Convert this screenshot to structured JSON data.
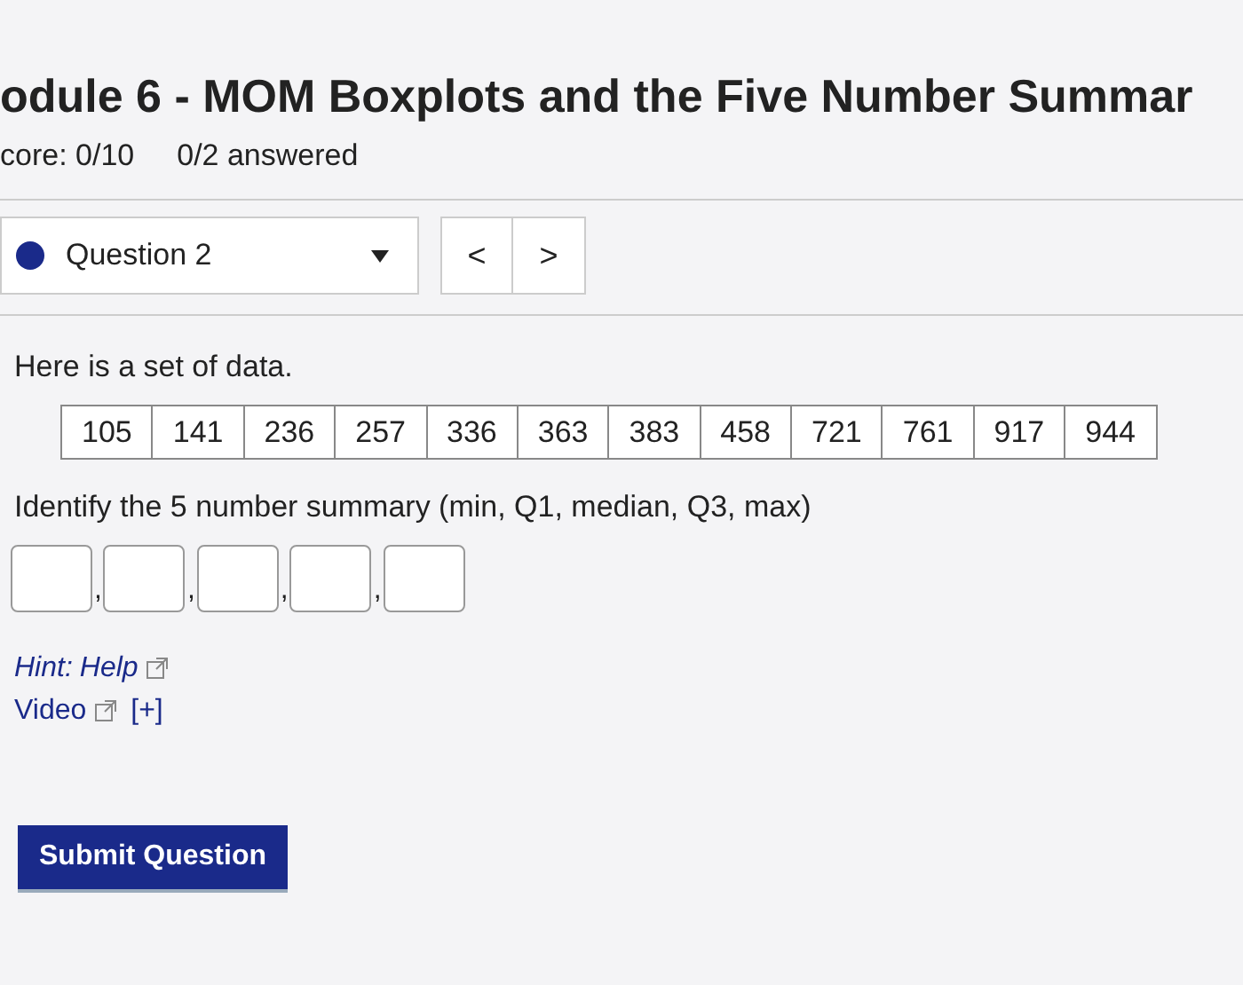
{
  "header": {
    "title": "odule 6 - MOM Boxplots and the Five Number Summar",
    "score": "core: 0/10",
    "answered": "0/2 answered"
  },
  "question_nav": {
    "label": "Question 2",
    "prev": "<",
    "next": ">"
  },
  "intro": "Here is a set of data.",
  "data_values": [
    "105",
    "141",
    "236",
    "257",
    "336",
    "363",
    "383",
    "458",
    "721",
    "761",
    "917",
    "944"
  ],
  "prompt": "Identify the 5 number summary (min, Q1, median, Q3, max)",
  "answer_fields": [
    {
      "kind": "input",
      "separator": ","
    },
    {
      "kind": "input",
      "separator": ","
    },
    {
      "kind": "input",
      "separator": ","
    },
    {
      "kind": "input",
      "separator": ","
    },
    {
      "kind": "input"
    }
  ],
  "hint": {
    "label": "Hint:",
    "help_link": "Help",
    "video_link": "Video",
    "expand": "[+]"
  },
  "submit_button": "Submit Question"
}
